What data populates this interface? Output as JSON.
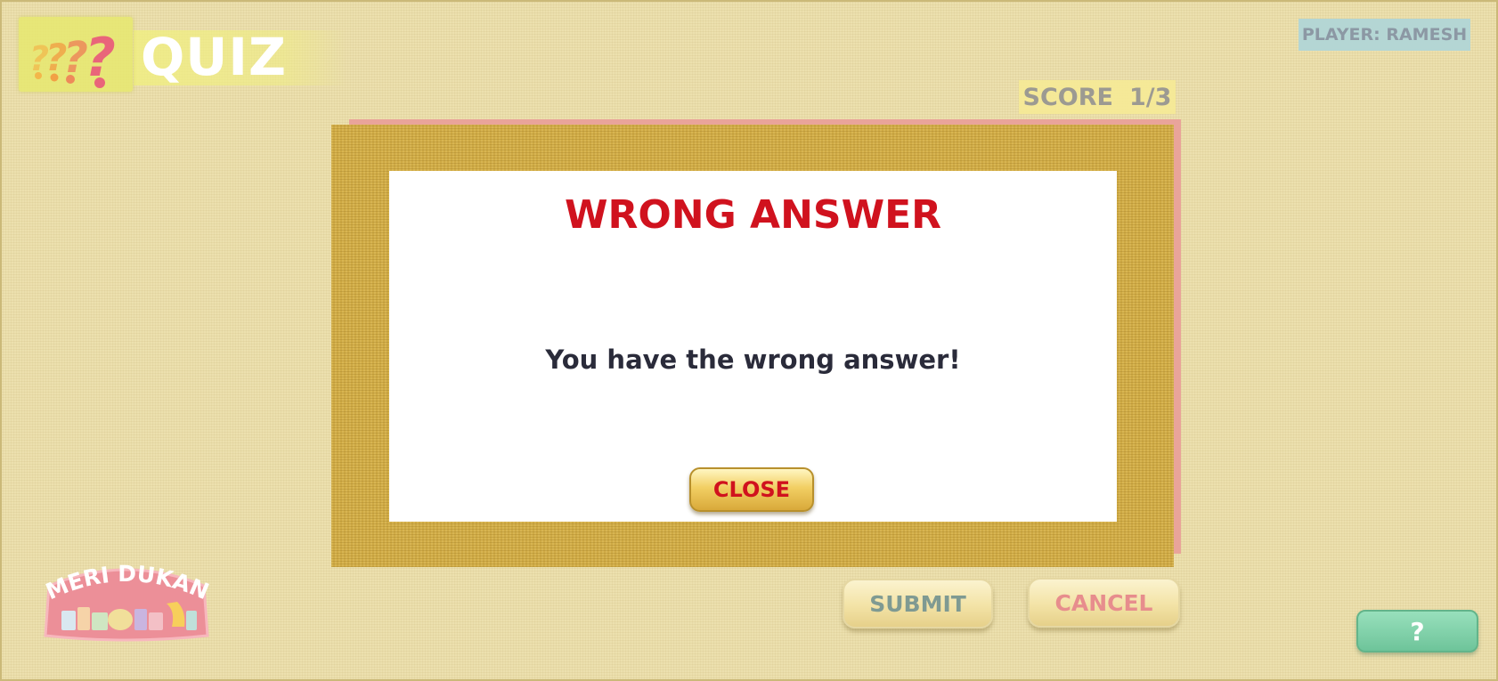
{
  "header": {
    "title": "QUIZ",
    "player_label": "PLAYER: RAMESH",
    "score_label": "SCORE",
    "score_value": "1/3",
    "quiz_icon": "question-marks-icon"
  },
  "dialog": {
    "title": "WRONG ANSWER",
    "message": "You have the wrong answer!",
    "close_label": "CLOSE"
  },
  "footer": {
    "submit_label": "SUBMIT",
    "cancel_label": "CANCEL",
    "help_label": "?",
    "brand_text": "MERI DUKAN"
  },
  "colors": {
    "background": "#ece0ae",
    "wrong_red": "#d0121e",
    "burlap": "#cfaa45",
    "player_badge": "#b4d6d4",
    "help_green": "#6ec49a"
  }
}
